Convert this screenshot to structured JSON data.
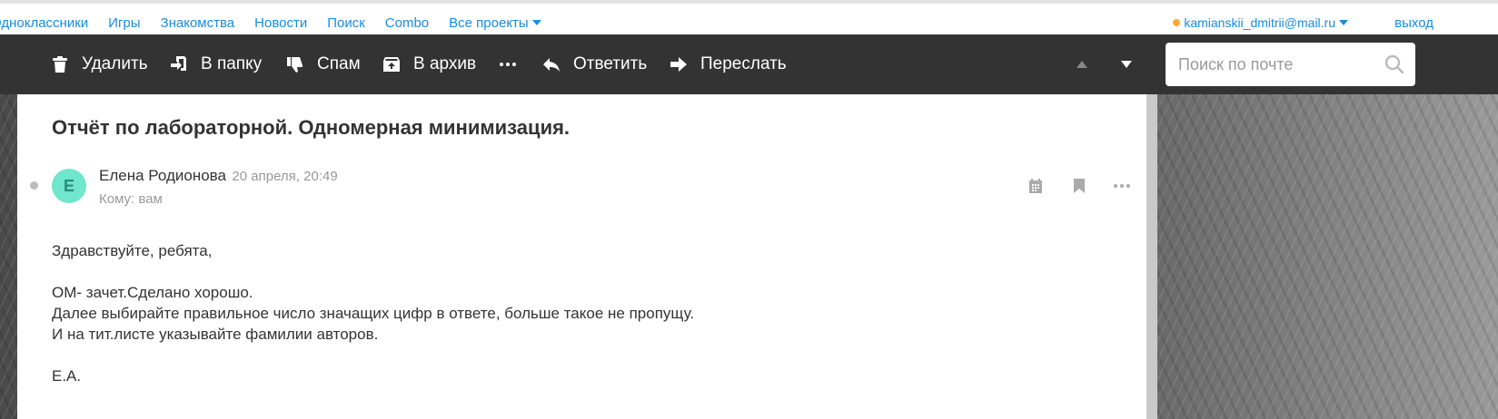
{
  "portal": {
    "links": [
      "Одноклассники",
      "Игры",
      "Знакомства",
      "Новости",
      "Поиск",
      "Combo"
    ],
    "all_projects": "Все проекты",
    "user_email": "kamianskii_dmitrii@mail.ru",
    "logout": "выход"
  },
  "toolbar": {
    "delete": "Удалить",
    "to_folder": "В папку",
    "spam": "Спам",
    "archive": "В архив",
    "reply": "Ответить",
    "forward": "Переслать",
    "search_placeholder": "Поиск по почте"
  },
  "letter": {
    "subject": "Отчёт по лабораторной. Одномерная минимизация.",
    "avatar_letter": "Е",
    "sender": "Елена Родионова",
    "date": "20 апреля, 20:49",
    "recipient": "Кому: вам",
    "body": {
      "greeting": "Здравствуйте, ребята,",
      "line1": "ОМ- зачет.Сделано хорошо.",
      "line2": "Далее выбирайте правильное число значащих цифр в ответе, больше такое не пропущу.",
      "line3": "И на тит.листе указывайте фамилии авторов.",
      "signature": "Е.А."
    }
  },
  "colors": {
    "link": "#168de2",
    "toolbar_bg": "#333333",
    "avatar_bg": "#70e6cc",
    "user_dot": "#ffa930"
  },
  "icons": [
    "trash-icon",
    "move-to-folder-icon",
    "thumbs-down-icon",
    "archive-icon",
    "more-icon",
    "reply-icon",
    "forward-icon",
    "arrow-up-icon",
    "arrow-down-icon",
    "search-icon",
    "calendar-icon",
    "bookmark-icon"
  ]
}
